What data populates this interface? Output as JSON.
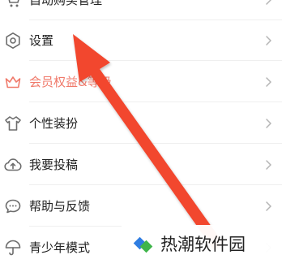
{
  "menu": {
    "items": [
      {
        "label": "自动购买管理",
        "icon": "cart-icon"
      },
      {
        "label": "设置",
        "icon": "gear-icon"
      },
      {
        "label": "会员权益&等级",
        "icon": "crown-icon",
        "color": "#f07a6b"
      },
      {
        "label": "个性装扮",
        "icon": "shirt-icon"
      },
      {
        "label": "我要投稿",
        "icon": "cloud-upload-icon"
      },
      {
        "label": "帮助与反馈",
        "icon": "chat-bubble-icon"
      },
      {
        "label": "青少年模式",
        "icon": "umbrella-icon"
      }
    ]
  },
  "annotation": {
    "arrow_color": "#f2462f",
    "points_to": "设置"
  },
  "watermark": {
    "text": "热潮软件园",
    "logo_colors": [
      "#2f7de1",
      "#3fb54a"
    ]
  }
}
